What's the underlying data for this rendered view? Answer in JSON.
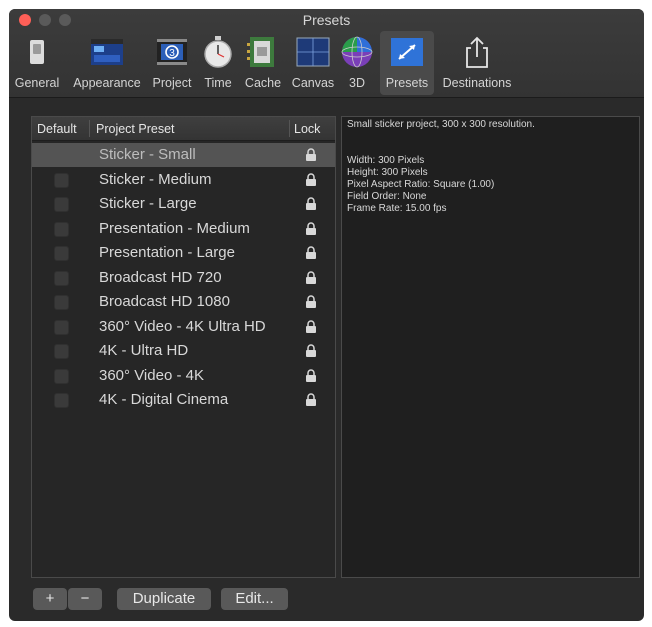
{
  "window": {
    "title": "Presets"
  },
  "toolbar": {
    "items": [
      {
        "label": "General",
        "icon": "switch-icon"
      },
      {
        "label": "Appearance",
        "icon": "window-appearance-icon"
      },
      {
        "label": "Project",
        "icon": "project-film-icon"
      },
      {
        "label": "Time",
        "icon": "stopwatch-icon"
      },
      {
        "label": "Cache",
        "icon": "memory-chip-icon"
      },
      {
        "label": "Canvas",
        "icon": "canvas-grid-icon"
      },
      {
        "label": "3D",
        "icon": "sphere-3d-icon"
      },
      {
        "label": "Presets",
        "icon": "presets-resize-icon",
        "selected": true
      },
      {
        "label": "Destinations",
        "icon": "share-icon"
      }
    ]
  },
  "table": {
    "headers": {
      "default": "Default",
      "preset": "Project Preset",
      "lock": "Lock"
    },
    "rows": [
      {
        "name": "Sticker - Small",
        "selected": true
      },
      {
        "name": "Sticker - Medium"
      },
      {
        "name": "Sticker - Large"
      },
      {
        "name": "Presentation - Medium"
      },
      {
        "name": "Presentation - Large"
      },
      {
        "name": "Broadcast HD 720"
      },
      {
        "name": "Broadcast HD 1080"
      },
      {
        "name": "360° Video - 4K Ultra HD"
      },
      {
        "name": "4K - Ultra HD"
      },
      {
        "name": "360° Video - 4K"
      },
      {
        "name": "4K - Digital Cinema"
      }
    ]
  },
  "description": {
    "summary": "Small sticker project, 300 x 300 resolution.",
    "properties": [
      "Width: 300 Pixels",
      "Height: 300 Pixels",
      "Pixel Aspect Ratio: Square (1.00)",
      "Field Order: None",
      "Frame Rate: 15.00 fps"
    ]
  },
  "buttons": {
    "add": "+",
    "remove": "−",
    "duplicate": "Duplicate",
    "edit": "Edit..."
  },
  "colors": {
    "close": "#fe5f57",
    "background": "#2a2a2a",
    "selected_row": "#545454"
  }
}
